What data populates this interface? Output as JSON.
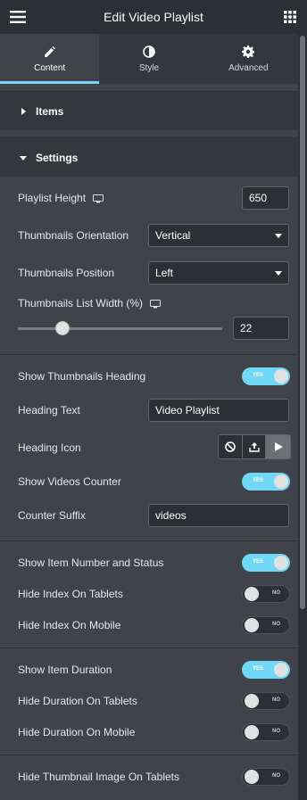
{
  "header": {
    "title": "Edit Video Playlist",
    "menu_icon": "hamburger-icon",
    "grid_icon": "apps-grid-icon"
  },
  "tabs": [
    {
      "label": "Content",
      "icon": "pencil-icon",
      "active": true
    },
    {
      "label": "Style",
      "icon": "half-circle-icon",
      "active": false
    },
    {
      "label": "Advanced",
      "icon": "gear-icon",
      "active": false
    }
  ],
  "sections": {
    "items": "Items",
    "settings": "Settings"
  },
  "settings": {
    "playlist_height": {
      "label": "Playlist Height",
      "value": "650"
    },
    "thumb_orientation": {
      "label": "Thumbnails Orientation",
      "value": "Vertical"
    },
    "thumb_position": {
      "label": "Thumbnails Position",
      "value": "Left"
    },
    "thumb_list_width": {
      "label": "Thumbnails List Width (%)",
      "value": "22",
      "slider_fraction": 0.22
    },
    "show_thumb_heading": {
      "label": "Show Thumbnails Heading",
      "state": "YES"
    },
    "heading_text": {
      "label": "Heading Text",
      "value": "Video Playlist"
    },
    "heading_icon": {
      "label": "Heading Icon"
    },
    "show_videos_counter": {
      "label": "Show Videos Counter",
      "state": "YES"
    },
    "counter_suffix": {
      "label": "Counter Suffix",
      "value": "videos"
    },
    "show_item_number": {
      "label": "Show Item Number and Status",
      "state": "YES"
    },
    "hide_index_tablets": {
      "label": "Hide Index On Tablets",
      "state": "NO"
    },
    "hide_index_mobile": {
      "label": "Hide Index On Mobile",
      "state": "NO"
    },
    "show_item_duration": {
      "label": "Show Item Duration",
      "state": "YES"
    },
    "hide_duration_tablets": {
      "label": "Hide Duration On Tablets",
      "state": "NO"
    },
    "hide_duration_mobile": {
      "label": "Hide Duration On Mobile",
      "state": "NO"
    },
    "hide_thumb_tablets": {
      "label": "Hide Thumbnail Image On Tablets",
      "state": "NO"
    }
  },
  "colors": {
    "accent": "#71d7f7",
    "panel": "#404349",
    "header": "#2c2f34"
  }
}
